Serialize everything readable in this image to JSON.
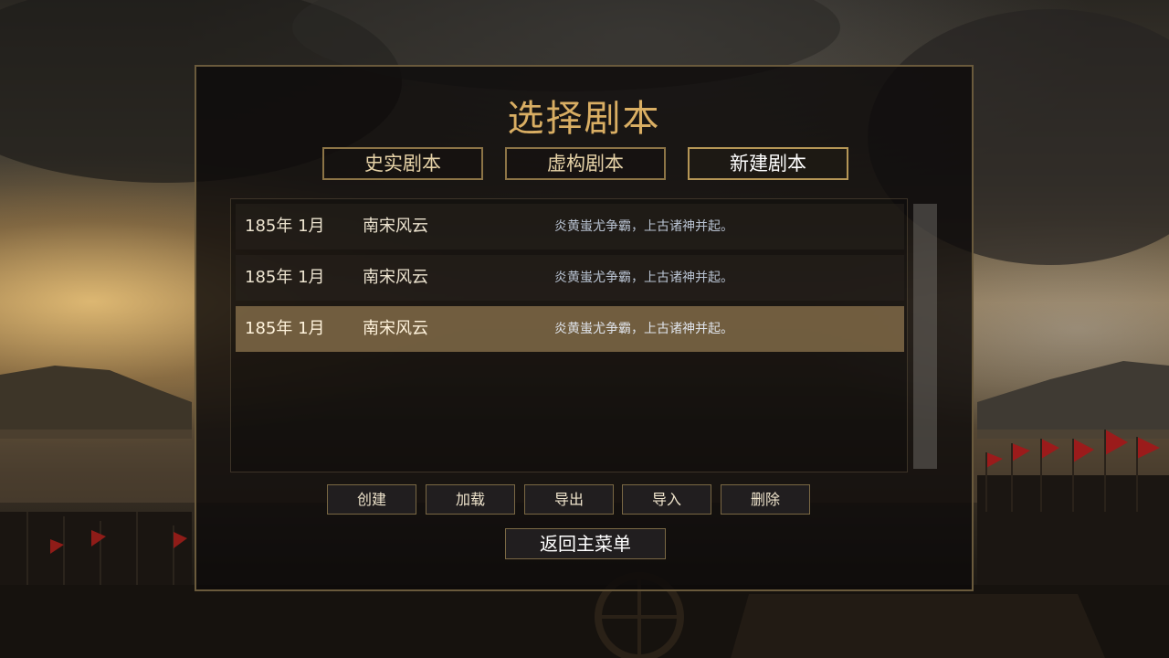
{
  "screen": {
    "title": "选择剧本"
  },
  "tabs": [
    {
      "label": "史实剧本",
      "active": false
    },
    {
      "label": "虚构剧本",
      "active": false
    },
    {
      "label": "新建剧本",
      "active": true
    }
  ],
  "scenarios": [
    {
      "date": "185年 1月",
      "name": "南宋风云",
      "description": "炎黄蚩尤争霸，上古诸神并起。",
      "selected": false
    },
    {
      "date": "185年 1月",
      "name": "南宋风云",
      "description": "炎黄蚩尤争霸，上古诸神并起。",
      "selected": false
    },
    {
      "date": "185年 1月",
      "name": "南宋风云",
      "description": "炎黄蚩尤争霸，上古诸神并起。",
      "selected": true
    }
  ],
  "actions": {
    "create": "创建",
    "load": "加载",
    "export": "导出",
    "import": "导入",
    "delete": "删除"
  },
  "return_button": "返回主菜单",
  "colors": {
    "title_gold": "#d9ae63",
    "tab_border": "#8c7446",
    "selected_row": "#806a48",
    "description_text": "#b9c3d2",
    "banner_red": "#9b1b1b"
  }
}
